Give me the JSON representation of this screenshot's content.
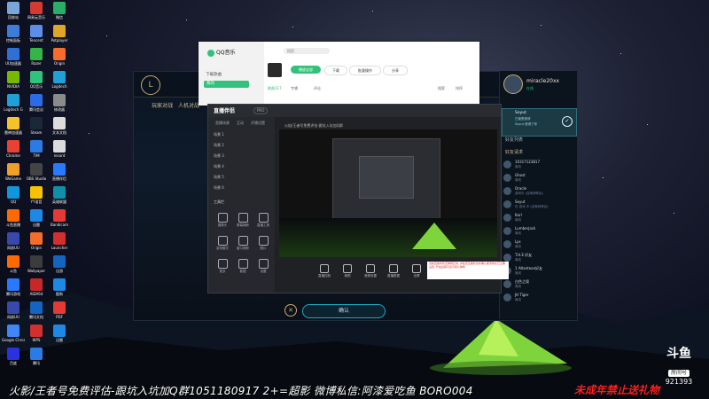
{
  "desktop_icons": [
    {
      "label": "回收站",
      "color": "#7aa7d8"
    },
    {
      "label": "网易云音乐",
      "color": "#d33a31"
    },
    {
      "label": "微信",
      "color": "#2aae67"
    },
    {
      "label": "控制面板",
      "color": "#3b7dd8"
    },
    {
      "label": "Tencent",
      "color": "#5b8ee6"
    },
    {
      "label": "Potplayer",
      "color": "#e0a526"
    },
    {
      "label": "UU加速器",
      "color": "#2f6fd6"
    },
    {
      "label": "Razer",
      "color": "#35b44a"
    },
    {
      "label": "Origin",
      "color": "#f56c2d"
    },
    {
      "label": "NVIDIA",
      "color": "#76b900"
    },
    {
      "label": "QQ音乐",
      "color": "#31c27c"
    },
    {
      "label": "Logitech",
      "color": "#1fa0d6"
    },
    {
      "label": "Logitech G",
      "color": "#1fa0d6"
    },
    {
      "label": "腾讯会议",
      "color": "#2b6be6"
    },
    {
      "label": "修改器",
      "color": "#8b8b8b"
    },
    {
      "label": "雷神加速器",
      "color": "#f3c329"
    },
    {
      "label": "Steam",
      "color": "#1b2838"
    },
    {
      "label": "文本文档",
      "color": "#dcdcdc"
    },
    {
      "label": "Chrome",
      "color": "#e94235"
    },
    {
      "label": "TIM",
      "color": "#2c7be5"
    },
    {
      "label": "record",
      "color": "#dcdcdc"
    },
    {
      "label": "WeGame",
      "color": "#ee9f27"
    },
    {
      "label": "OBS Studio",
      "color": "#444"
    },
    {
      "label": "直播伴侣",
      "color": "#2979ff"
    },
    {
      "label": "QQ",
      "color": "#1296db"
    },
    {
      "label": "YY语音",
      "color": "#f7c300"
    },
    {
      "label": "英雄联盟",
      "color": "#0f8fa8"
    },
    {
      "label": "斗鱼直播",
      "color": "#ff6a00"
    },
    {
      "label": "迅雷",
      "color": "#1e88e5"
    },
    {
      "label": "Bandicam",
      "color": "#e53935"
    },
    {
      "label": "网易UU",
      "color": "#3949ab"
    },
    {
      "label": "Origin",
      "color": "#f56c2d"
    },
    {
      "label": "Launcher",
      "color": "#d32f2f"
    },
    {
      "label": "斗鱼",
      "color": "#ff6a00"
    },
    {
      "label": "Wallpaper",
      "color": "#3c3c3c"
    },
    {
      "label": "迅游",
      "color": "#1565c0"
    },
    {
      "label": "腾讯游戏",
      "color": "#2979ff"
    },
    {
      "label": "AIDA64",
      "color": "#c62828"
    },
    {
      "label": "酷狗",
      "color": "#1e88e5"
    },
    {
      "label": "网易UU",
      "color": "#3949ab"
    },
    {
      "label": "腾讯文档",
      "color": "#1565c0"
    },
    {
      "label": "PDF",
      "color": "#e53935"
    },
    {
      "label": "Google Chrome",
      "color": "#4285f4"
    },
    {
      "label": "WPS",
      "color": "#d32f2f"
    },
    {
      "label": "迅雷",
      "color": "#1e88e5"
    },
    {
      "label": "百度",
      "color": "#2932e1"
    },
    {
      "label": "腾讯",
      "color": "#2c7be5"
    }
  ],
  "game": {
    "logo": "L",
    "nav": [
      "玩家对战",
      "人机对战"
    ],
    "confirm_label": "确认",
    "close_label": "✕"
  },
  "friends": {
    "username": "miracle20xx",
    "level": "391",
    "status": "在线",
    "section_title": "好友列表",
    "card_name": "Soyut",
    "card_line1": "已接受邀请",
    "card_line2": "Soyut 邀请了你",
    "group_label": "好友请求",
    "rows": [
      {
        "name": "10317123817",
        "status": "离线"
      },
      {
        "name": "Ghost",
        "status": "离线"
      },
      {
        "name": "Oracle",
        "status": "游戏中 (召唤师峡谷)"
      },
      {
        "name": "Soyut",
        "status": "在 游戏 中 (召唤师峡谷)"
      },
      {
        "name": "Karl",
        "status": "离线"
      },
      {
        "name": "Lumberjack",
        "status": "离线"
      },
      {
        "name": "Lyx",
        "status": "离线"
      },
      {
        "name": "T.H.E 好友",
        "status": "离线"
      },
      {
        "name": "1 Atlantean好友",
        "status": "离线"
      },
      {
        "name": "白色之境",
        "status": "离线"
      },
      {
        "name": "JH Tiger",
        "status": "离线"
      }
    ]
  },
  "qq": {
    "app_name": "QQ音乐",
    "search_placeholder": "搜索",
    "side_items": [
      "在线音乐",
      "下载歌曲",
      "乐馆",
      "我的音乐"
    ],
    "selected_item": "我的",
    "btn_play": "播放全部",
    "btn_download": "下载",
    "btn_batch": "批量操作",
    "btn_share": "分享",
    "tabs": [
      "歌曲117",
      "专辑",
      "评论"
    ],
    "right_tabs": [
      "搜索",
      "排序"
    ]
  },
  "obs": {
    "brand": "直播伴侣",
    "badge": "PRO",
    "tabs": [
      "直播场景",
      "互动",
      "开播设置"
    ],
    "live_title": "火焰/王者号免费评估-跟坑入坑加Q群",
    "scenes": [
      "场景 1",
      "场景 2",
      "场景 3",
      "场景 4",
      "场景 5",
      "场景 6"
    ],
    "tools_label": "工具栏",
    "tools": [
      {
        "label": "摄像头"
      },
      {
        "label": "屏幕捕获"
      },
      {
        "label": "直播工具"
      },
      {
        "label": "游戏模式"
      },
      {
        "label": "窗口捕获"
      },
      {
        "label": "图片"
      },
      {
        "label": "更多"
      },
      {
        "label": "数据"
      },
      {
        "label": "设置"
      }
    ],
    "preview_buttons": [
      {
        "label": "直播控制"
      },
      {
        "label": "美颜"
      },
      {
        "label": "音频设置"
      },
      {
        "label": "直播数据"
      },
      {
        "label": "全屏"
      },
      {
        "label": "开播"
      }
    ],
    "tip_text": "当前直播间暂无弹幕互动, 请检查直播状态并确认推流地址已正确设置, 开启后即可显示观众弹幕"
  },
  "overlay": {
    "ticker": "火影/王者号免费评估-跟坑入坑加Q群1051180917 2+=超影 微博私信:阿漆爱吃鱼 BORO004",
    "warning": "未成年禁止送礼物",
    "douyu_logo": "斗鱼",
    "room_label": "房间号",
    "room_number": "921393"
  }
}
